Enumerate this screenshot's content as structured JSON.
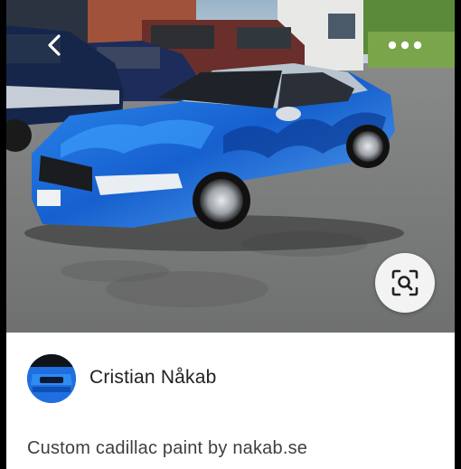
{
  "photo": {
    "description_icons": [
      "back-arrow-icon",
      "more-dots-icon",
      "visual-search-icon"
    ]
  },
  "post": {
    "author": "Cristian Nåkab",
    "caption": "Custom cadillac paint by nakab.se"
  },
  "colors": {
    "car_blue": "#1f6fe0",
    "card_bg": "#ffffff",
    "lens_bg": "#f3f3f3"
  }
}
